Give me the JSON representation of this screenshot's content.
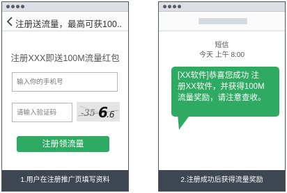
{
  "left_panel": {
    "nav_title": "注册送流量，最高可获100..",
    "promo_text": "注册XXX即送100M流量红包",
    "phone_placeholder": "输入你的手机号",
    "code_placeholder": "请输入验证码",
    "captcha_text": "-356.6",
    "register_button": "注册领流量",
    "caption": "1.用户在注册推广页填写资料"
  },
  "right_panel": {
    "sms_title": "短信",
    "sms_time": "今天 上午 8:00",
    "message_line1": "[XX软件]恭喜您成功 注",
    "message_line2": "册XX软件，并获得100M",
    "message_line3": "流量奖励，请注意查收。",
    "caption": "2.注册成功后获得流量奖励"
  },
  "colors": {
    "accent_green": "#2eaa62",
    "caption_bar": "#3d4651",
    "phone_frame": "#4d5661",
    "status_bar": "#dcdfe3"
  },
  "icons": {
    "back": "chevron-left-icon",
    "status_dots": "status-dots-icon"
  }
}
